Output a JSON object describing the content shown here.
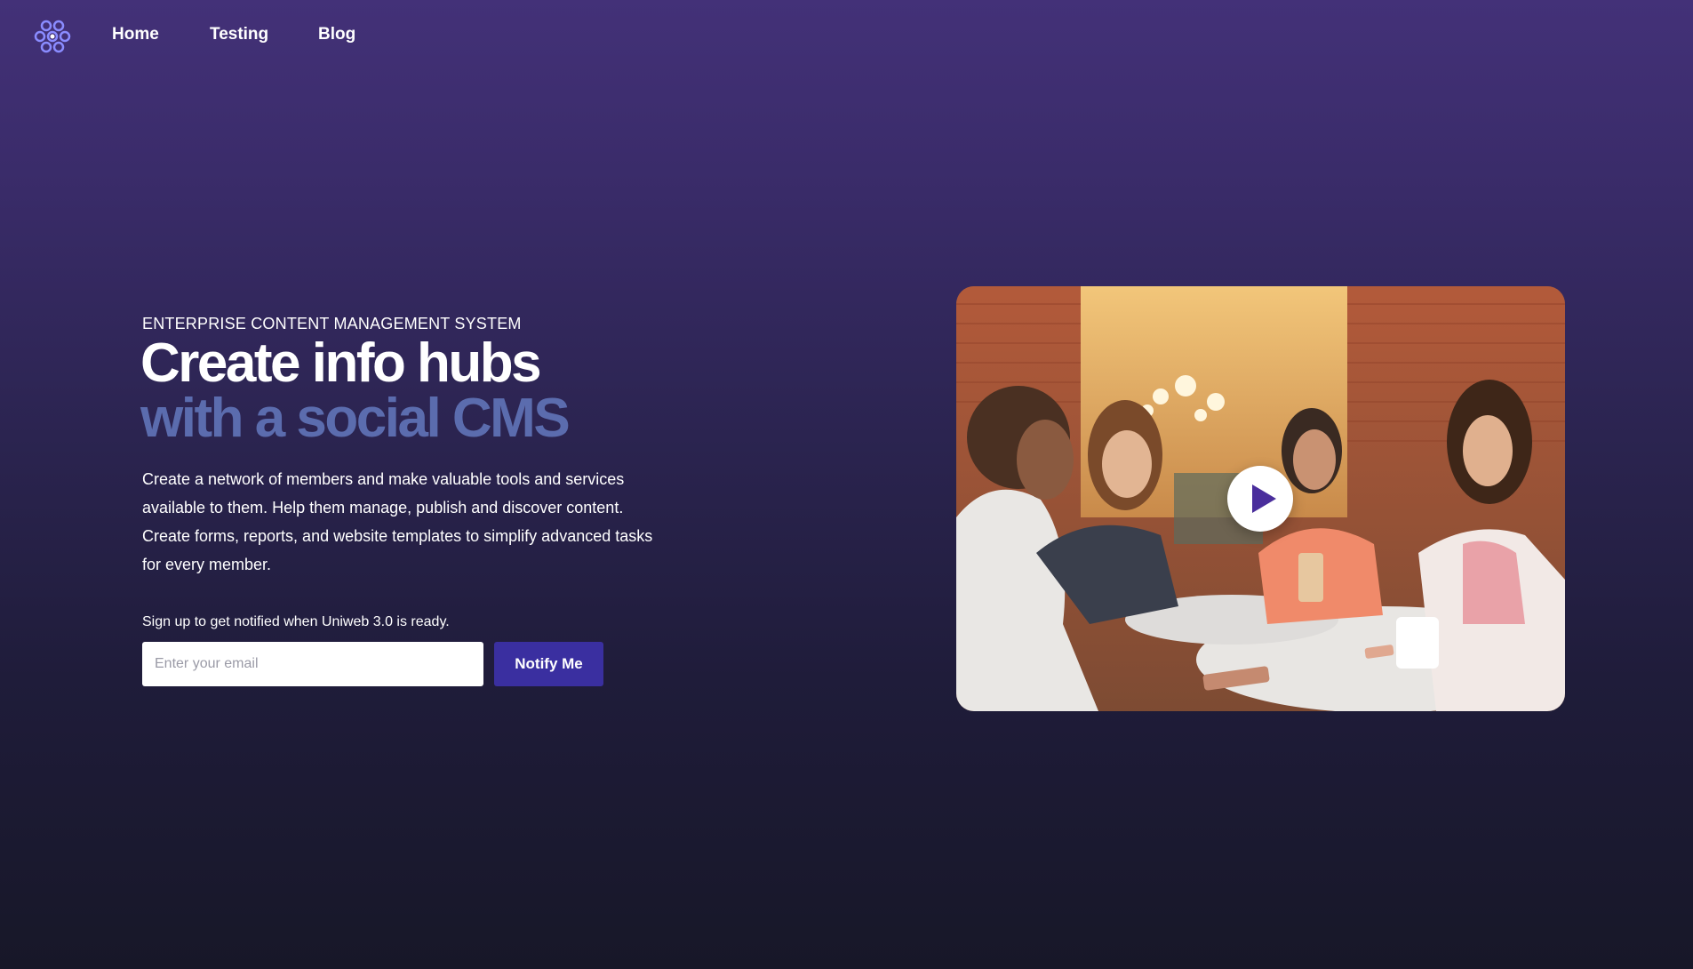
{
  "nav": {
    "logo_icon": "network-nodes-logo",
    "links": [
      {
        "label": "Home"
      },
      {
        "label": "Testing"
      },
      {
        "label": "Blog"
      }
    ]
  },
  "hero": {
    "eyebrow": "ENTERPRISE CONTENT MANAGEMENT SYSTEM",
    "headline_line1": "Create info hubs",
    "headline_line2": "with a social CMS",
    "description": "Create a network of members and make valuable tools and services available to them. Help them manage, publish and discover content. Create forms, reports, and website templates to simplify advanced tasks for every member.",
    "signup_text": "Sign up to get notified when Uniweb 3.0 is ready.",
    "email_placeholder": "Enter your email",
    "notify_label": "Notify Me"
  },
  "video": {
    "play_icon": "play-icon"
  },
  "colors": {
    "accent_text": "#5b6cae",
    "button": "#3a2fa0",
    "play_triangle": "#4a2e9c"
  }
}
